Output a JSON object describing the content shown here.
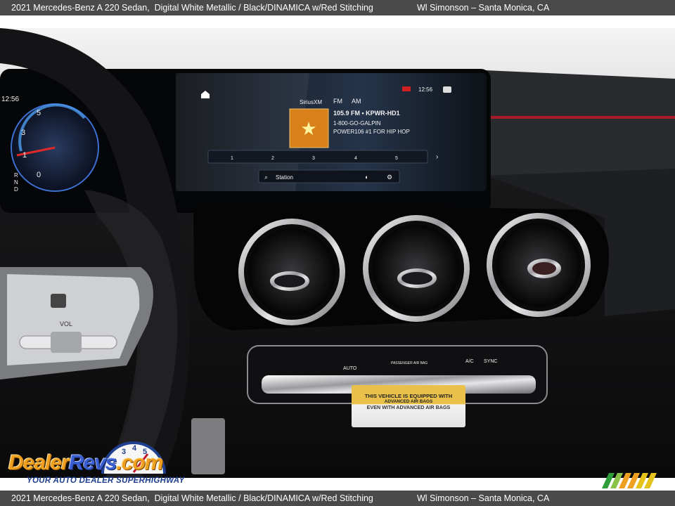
{
  "caption": {
    "vehicle": "2021 Mercedes-Benz A 220 Sedan,",
    "color": "Digital White Metallic",
    "separator": "/",
    "interior": "Black/DINAMICA w/Red Stitching",
    "dealer": "Wl Simonson – Santa Monica, CA"
  },
  "cluster": {
    "time": "12:56",
    "gear_letters": [
      "R",
      "N",
      "D"
    ],
    "gauge_numbers": [
      "5",
      "3",
      "1",
      "0"
    ]
  },
  "infotainment": {
    "source": "SiriusXM",
    "bands": [
      "FM",
      "AM"
    ],
    "clock": "12:56",
    "station": "105.9 FM • KPWR-HD1",
    "phone": "1-800-GO-GALPIN",
    "slogan": "POWER106 #1 FOR HIP HOP",
    "presets": [
      "1",
      "2",
      "3",
      "4",
      "5"
    ],
    "station_button": "Station"
  },
  "steering": {
    "vol_label": "VOL"
  },
  "climate": {
    "auto": "AUTO",
    "passenger_airbag": "PASSENGER AIR BAG",
    "ac": "A/C",
    "sync": "SYNC"
  },
  "airbag_label": {
    "line1": "THIS VEHICLE IS EQUIPPED WITH",
    "line2": "ADVANCED AIR BAGS",
    "line3": "EVEN WITH ADVANCED AIR BAGS"
  },
  "watermark": {
    "brand_part1": "Dealer",
    "brand_part2": "Revs",
    "brand_part3": ".com",
    "tagline": "YOUR AUTO DEALER SUPERHIGHWAY",
    "gauge_digits": [
      "2",
      "3",
      "4",
      "5",
      "6"
    ]
  },
  "colors": {
    "caption_bar": "#4a4a4a",
    "ambient_red": "#c0182a",
    "watermark_orange": "#f0a020",
    "watermark_blue": "#3a5fd0"
  }
}
